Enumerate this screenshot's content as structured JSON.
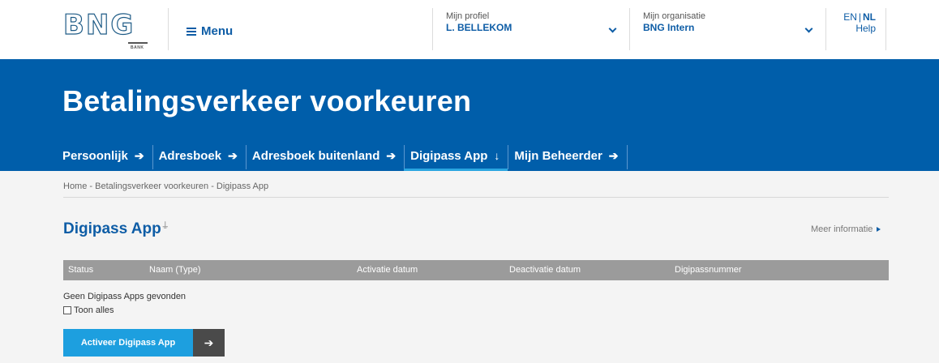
{
  "header": {
    "logo_text": "BNG",
    "logo_subtext": "BANK",
    "menu_label": "Menu",
    "profile": {
      "label": "Mijn profiel",
      "value": "L. BELLEKOM"
    },
    "organisation": {
      "label": "Mijn organisatie",
      "value": "BNG Intern"
    },
    "lang_en": "EN",
    "lang_sep": "|",
    "lang_nl": "NL",
    "help": "Help"
  },
  "banner": {
    "title": "Betalingsverkeer voorkeuren",
    "tabs": [
      {
        "label": "Persoonlijk",
        "arrow": "➔",
        "active": false
      },
      {
        "label": "Adresboek",
        "arrow": "➔",
        "active": false
      },
      {
        "label": "Adresboek buitenland",
        "arrow": "➔",
        "active": false
      },
      {
        "label": "Digipass App",
        "arrow": "↓",
        "active": true
      },
      {
        "label": "Mijn Beheerder",
        "arrow": "➔",
        "active": false
      }
    ]
  },
  "breadcrumb": "Home - Betalingsverkeer voorkeuren - Digipass App",
  "section": {
    "title": "Digipass App",
    "pin_icon": "pin-icon",
    "more_info": "Meer informatie"
  },
  "table": {
    "columns": [
      "Status",
      "Naam (Type)",
      "Activatie datum",
      "Deactivatie datum",
      "Digipassnummer"
    ],
    "empty_message": "Geen Digipass Apps gevonden"
  },
  "show_all_label": "Toon alles",
  "activate_button": {
    "label": "Activeer Digipass App",
    "arrow": "➔"
  },
  "colors": {
    "brand_blue": "#005eaa",
    "accent_blue": "#1d9fdf",
    "table_header": "#9b9b9b"
  }
}
